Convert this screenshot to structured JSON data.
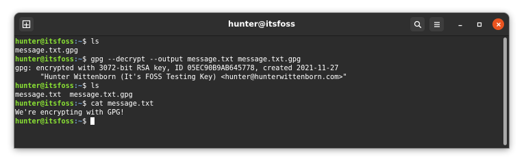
{
  "window": {
    "title": "hunter@itsfoss"
  },
  "prompt": {
    "user_host": "hunter@itsfoss",
    "path": ":~",
    "sign": "$ "
  },
  "lines": [
    {
      "type": "command",
      "text": "ls"
    },
    {
      "type": "output",
      "text": "message.txt.gpg"
    },
    {
      "type": "command",
      "text": "gpg --decrypt --output message.txt message.txt.gpg"
    },
    {
      "type": "output",
      "text": "gpg: encrypted with 3072-bit RSA key, ID 05EC90B9AB645778, created 2021-11-27"
    },
    {
      "type": "output",
      "text": "      \"Hunter Wittenborn (It's FOSS Testing Key) <hunter@hunterwittenborn.com>\""
    },
    {
      "type": "command",
      "text": "ls"
    },
    {
      "type": "output",
      "text": "message.txt  message.txt.gpg"
    },
    {
      "type": "command",
      "text": "cat message.txt"
    },
    {
      "type": "output",
      "text": "We're encrypting with GPG!"
    },
    {
      "type": "command",
      "text": ""
    }
  ],
  "colors": {
    "prompt_user": "#8ae234",
    "prompt_path": "#729fcf",
    "close_button": "#e95420",
    "terminal_bg": "#2c2c2c"
  },
  "icons": {
    "new_tab": "new-tab-icon",
    "search": "search-icon",
    "menu": "hamburger-menu-icon",
    "minimize": "minimize-icon",
    "maximize": "maximize-icon",
    "close": "close-icon"
  }
}
